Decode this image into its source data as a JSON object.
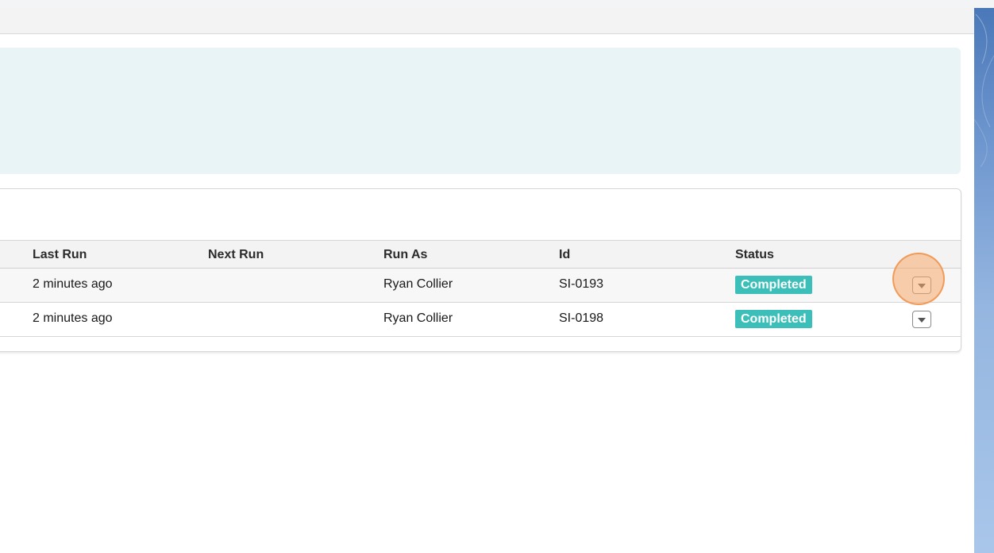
{
  "table": {
    "columns": {
      "last_run": "Last Run",
      "next_run": "Next Run",
      "run_as": "Run As",
      "id": "Id",
      "status": "Status"
    },
    "rows": [
      {
        "last_run": "2 minutes ago",
        "next_run": "",
        "run_as": "Ryan Collier",
        "id": "SI-0193",
        "status": "Completed",
        "action_icon": "chevron-down-icon"
      },
      {
        "last_run": "2 minutes ago",
        "next_run": "",
        "run_as": "Ryan Collier",
        "id": "SI-0198",
        "status": "Completed",
        "action_icon": "chevron-down-icon"
      }
    ]
  },
  "colors": {
    "status_completed": "#3bbfb8",
    "info_panel": "#e9f4f6",
    "highlight": "#f5aa6e",
    "rail_top": "#4a78b8",
    "rail_bottom": "#a9c6ea"
  }
}
